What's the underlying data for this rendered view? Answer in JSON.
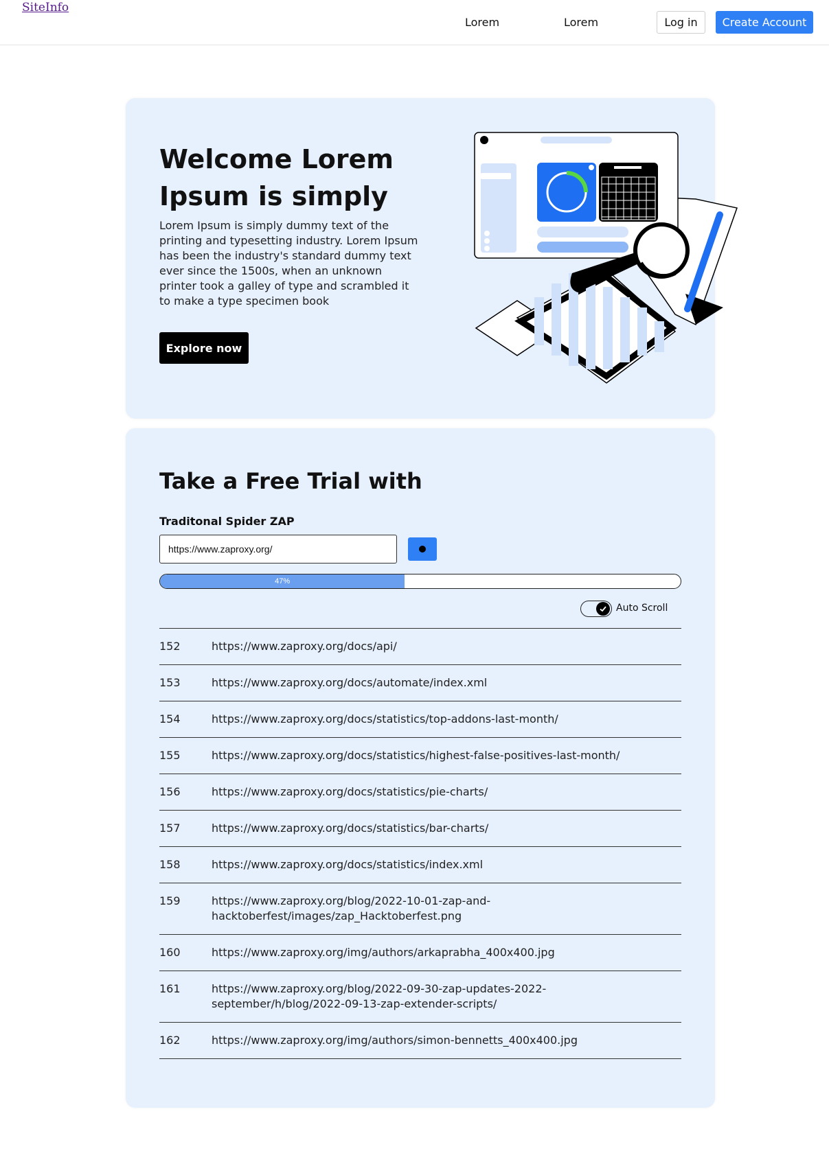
{
  "header": {
    "brand": "SiteInfo",
    "nav": [
      "Lorem",
      "Lorem"
    ],
    "login_label": "Log in",
    "create_account_label": "Create Account"
  },
  "hero": {
    "title": "Welcome Lorem Ipsum is simply",
    "body": "Lorem Ipsum is simply dummy text of the printing and typesetting industry. Lorem Ipsum has been the industry's standard dummy text ever since the 1500s, when an unknown printer took a galley of type and scrambled it to make a type specimen book",
    "cta_label": "Explore now"
  },
  "trial": {
    "title": "Take a Free Trial with",
    "field_label": "Traditonal Spider ZAP",
    "url_value": "https://www.zaproxy.org/",
    "progress_percent": 47,
    "progress_label": "47%",
    "auto_scroll_label": "Auto Scroll",
    "auto_scroll_on": true,
    "results": [
      {
        "num": "152",
        "url": "https://www.zaproxy.org/docs/api/"
      },
      {
        "num": "153",
        "url": "https://www.zaproxy.org/docs/automate/index.xml"
      },
      {
        "num": "154",
        "url": "https://www.zaproxy.org/docs/statistics/top-addons-last-month/"
      },
      {
        "num": "155",
        "url": "https://www.zaproxy.org/docs/statistics/highest-false-positives-last-month/"
      },
      {
        "num": "156",
        "url": "https://www.zaproxy.org/docs/statistics/pie-charts/"
      },
      {
        "num": "157",
        "url": "https://www.zaproxy.org/docs/statistics/bar-charts/"
      },
      {
        "num": "158",
        "url": "https://www.zaproxy.org/docs/statistics/index.xml"
      },
      {
        "num": "159",
        "url": "https://www.zaproxy.org/blog/2022-10-01-zap-and-hacktoberfest/images/zap_Hacktoberfest.png"
      },
      {
        "num": "160",
        "url": "https://www.zaproxy.org/img/authors/arkaprabha_400x400.jpg"
      },
      {
        "num": "161",
        "url": "https://www.zaproxy.org/blog/2022-09-30-zap-updates-2022-september/h/blog/2022-09-13-zap-extender-scripts/"
      },
      {
        "num": "162",
        "url": "https://www.zaproxy.org/img/authors/simon-bennetts_400x400.jpg"
      }
    ]
  },
  "colors": {
    "accent": "#2f80f5",
    "card_bg": "#e7f0fd",
    "progress_fill": "#6a9ff0",
    "chart_green": "#5ad642"
  }
}
